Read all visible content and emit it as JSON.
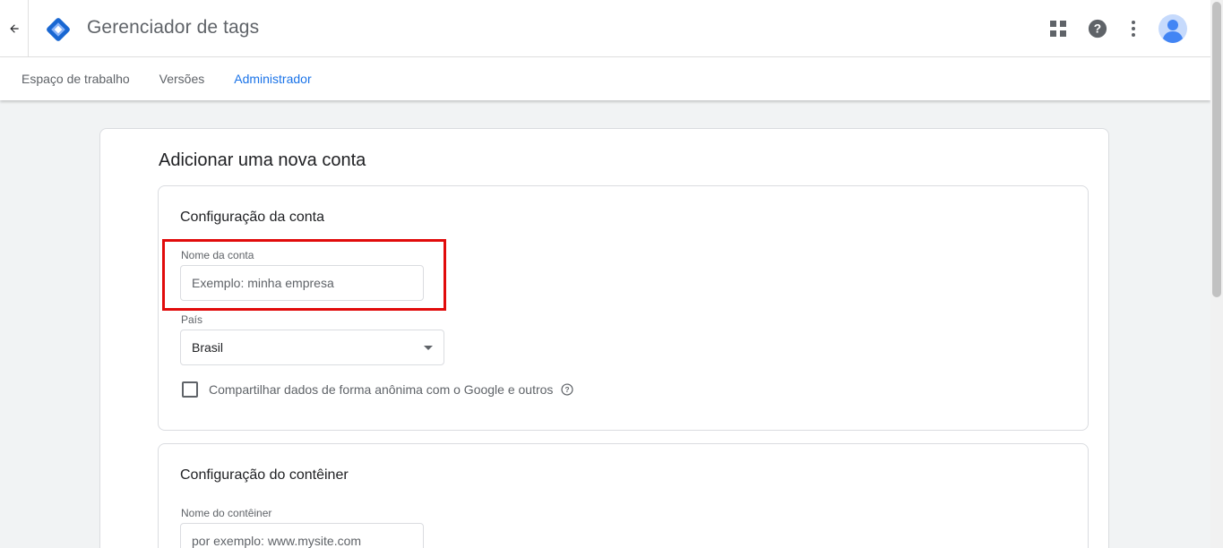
{
  "header": {
    "back_icon": "arrow-back-icon",
    "logo_icon": "tag-manager-logo",
    "app_title": "Gerenciador de tags",
    "icons": [
      "apps-icon",
      "help-icon",
      "more-vert-icon",
      "account-avatar"
    ]
  },
  "nav": {
    "tabs": [
      {
        "label": "Espaço de trabalho",
        "active": false
      },
      {
        "label": "Versões",
        "active": false
      },
      {
        "label": "Administrador",
        "active": true
      }
    ]
  },
  "form": {
    "title": "Adicionar uma nova conta",
    "account_section": {
      "title": "Configuração da conta",
      "account_name": {
        "label": "Nome da conta",
        "value": "",
        "placeholder": "Exemplo: minha empresa"
      },
      "country": {
        "label": "País",
        "selected": "Brasil"
      },
      "share_data": {
        "label": "Compartilhar dados de forma anônima com o Google e outros",
        "checked": false
      }
    },
    "container_section": {
      "title": "Configuração do contêiner",
      "container_name": {
        "label": "Nome do contêiner",
        "value": "",
        "placeholder": "por exemplo: www.mysite.com"
      }
    }
  },
  "colors": {
    "accent": "#1a73e8",
    "highlight": "#e10b0b",
    "logo_dark": "#1967d2",
    "logo_light": "#8ab4f8"
  }
}
